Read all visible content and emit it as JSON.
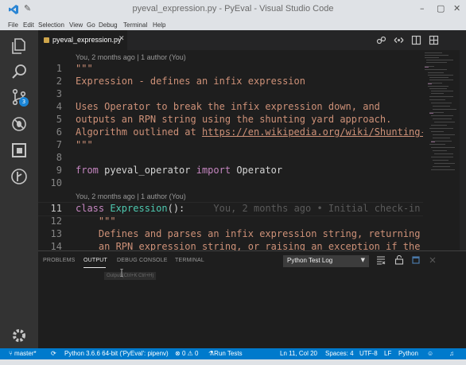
{
  "window": {
    "title": "pyeval_expression.py - PyEval - Visual Studio Code",
    "controls": [
      "–",
      "▢",
      "✕"
    ]
  },
  "menu": [
    "File",
    "Edit",
    "Selection",
    "View",
    "Go",
    "Debug",
    "Terminal",
    "Help"
  ],
  "activity_bar": {
    "icons": [
      "explorer-icon",
      "search-icon",
      "source-control-icon",
      "debug-icon",
      "extensions-icon",
      "git-lens-icon",
      "settings-gear-icon"
    ],
    "scm_badge": "3"
  },
  "tab": {
    "filename": "pyeval_expression.py",
    "close": "✕"
  },
  "editor": {
    "blame_header_1": "You, 2 months ago | 1 author (You)",
    "blame_header_2": "You, 2 months ago | 1 author (You)",
    "lines": [
      {
        "n": "1",
        "text": "\"\"\""
      },
      {
        "n": "2",
        "text": "Expression - defines an infix expression"
      },
      {
        "n": "3",
        "text": ""
      },
      {
        "n": "4",
        "text": "Uses Operator to break the infix expression down, and"
      },
      {
        "n": "5",
        "text": "outputs an RPN string using the shunting yard approach."
      },
      {
        "n": "6",
        "text_a": "Algorithm outlined at ",
        "text_b": "https://en.wikipedia.org/wiki/Shunting-"
      },
      {
        "n": "7",
        "text": "\"\"\""
      },
      {
        "n": "8",
        "text": ""
      },
      {
        "n": "9",
        "kw1": "from",
        "mod": " pyeval_operator ",
        "kw2": "import",
        "name": " Operator"
      },
      {
        "n": "10",
        "text": ""
      },
      {
        "n": "11",
        "kw": "class",
        "cls": " Expression",
        "rest": "():",
        "ghost": "     You, 2 months ago • Initial check-in"
      },
      {
        "n": "12",
        "text": "    \"\"\""
      },
      {
        "n": "13",
        "text": "    Defines and parses an infix expression string, returning"
      },
      {
        "n": "14",
        "text": "    an RPN expression string, or raising an exception if the"
      }
    ]
  },
  "panel": {
    "tabs": [
      "PROBLEMS",
      "OUTPUT",
      "DEBUG CONSOLE",
      "TERMINAL"
    ],
    "active_tab": "OUTPUT",
    "select_value": "Python Test Log",
    "select_arrow": "▼",
    "tooltip": "Output (Ctrl+K Ctrl+H)"
  },
  "status": {
    "branch": "master*",
    "sync": "⟳",
    "interpreter": "Python 3.6.6 64-bit ('PyEval': pipenv)",
    "errors": "0",
    "warnings": "0",
    "run_tests": "Run Tests",
    "position": "Ln 11, Col 20",
    "spaces": "Spaces: 4",
    "encoding": "UTF-8",
    "eol": "LF",
    "language": "Python"
  },
  "colors": {
    "accent": "#007acc",
    "badge": "#1a85d6",
    "string": "#ce9178",
    "keyword": "#c586c0",
    "class": "#4ec9b0"
  }
}
